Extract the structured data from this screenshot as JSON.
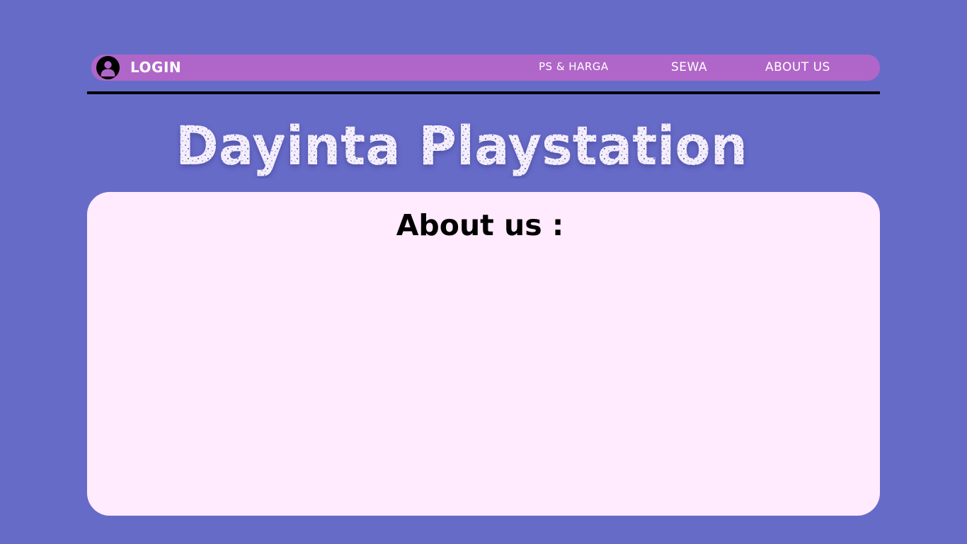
{
  "navbar": {
    "login_label": "LOGIN",
    "links": [
      {
        "label": "PS & HARGA"
      },
      {
        "label": "SEWA"
      },
      {
        "label": "ABOUT US"
      }
    ]
  },
  "header": {
    "title": "Dayinta Playstation"
  },
  "content": {
    "heading": "About us :"
  },
  "colors": {
    "background": "#676bc8",
    "navbar": "#b066c8",
    "card": "#ffeafe",
    "title_fill": "#f4eefb",
    "title_speckle": "#6e6fbf"
  },
  "icons": {
    "user": "user-circle-icon"
  }
}
